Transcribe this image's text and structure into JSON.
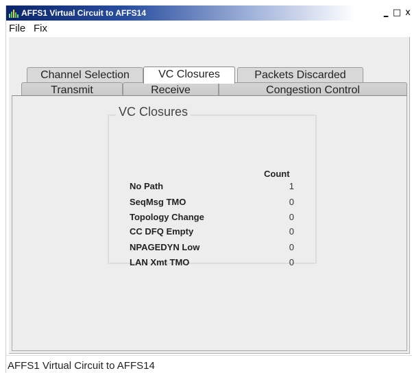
{
  "window": {
    "title": "AFFS1 Virtual Circuit to AFFS14",
    "min_label": "_",
    "max_label": "□",
    "close_label": "x"
  },
  "menu": {
    "file": "File",
    "fix": "Fix"
  },
  "tabs": {
    "row1": [
      "Channel Selection",
      "VC Closures",
      "Packets Discarded"
    ],
    "row2": [
      "Transmit",
      "Receive",
      "Congestion Control"
    ],
    "active": "VC Closures"
  },
  "vc_closures": {
    "title": "VC Closures",
    "count_header": "Count",
    "rows": [
      {
        "label": "No Path",
        "value": "1"
      },
      {
        "label": "SeqMsg TMO",
        "value": "0"
      },
      {
        "label": "Topology Change",
        "value": "0"
      },
      {
        "label": "CC DFQ Empty",
        "value": "0"
      },
      {
        "label": "NPAGEDYN Low",
        "value": "0"
      },
      {
        "label": "LAN Xmt TMO",
        "value": "0"
      }
    ]
  },
  "status": {
    "text": "AFFS1 Virtual Circuit to AFFS14"
  },
  "colors": {
    "title_bar": "#0a246a",
    "panel_bg": "#ededed"
  }
}
